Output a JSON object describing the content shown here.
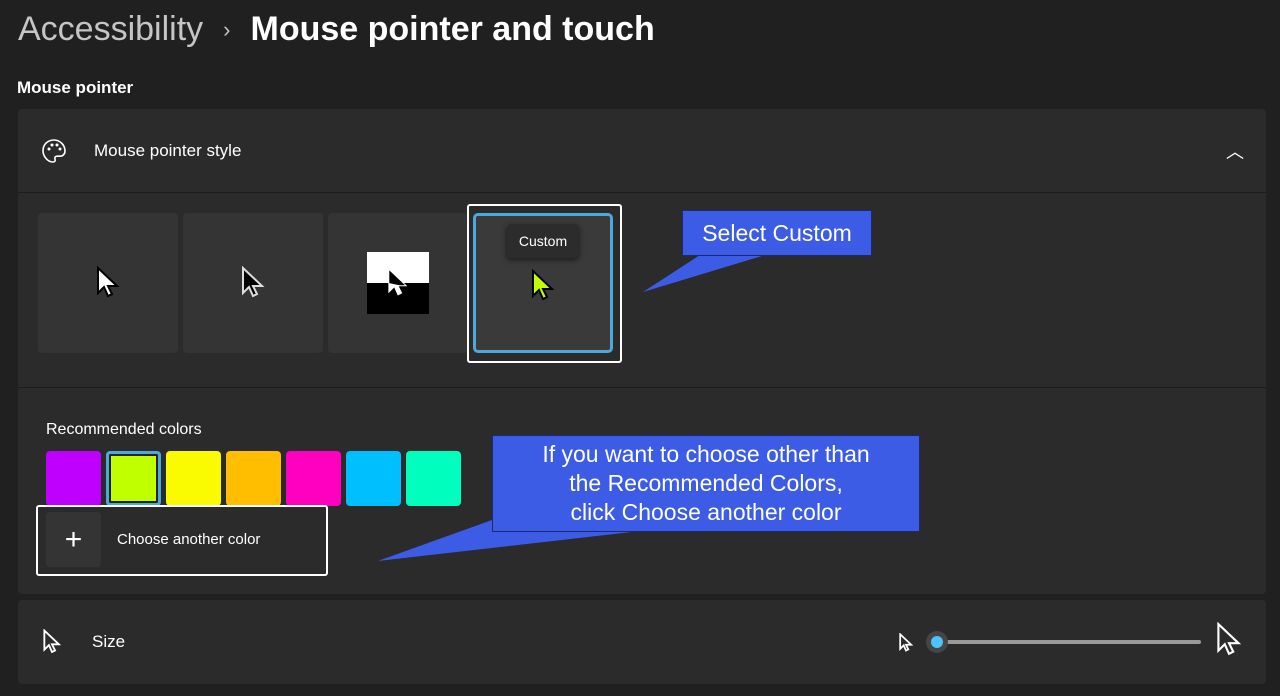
{
  "breadcrumb": {
    "parent": "Accessibility",
    "separator": "›",
    "current": "Mouse pointer and touch"
  },
  "section_title": "Mouse pointer",
  "pointer_style": {
    "label": "Mouse pointer style",
    "icon": "palette-icon",
    "expanded": true,
    "options": [
      {
        "name": "white"
      },
      {
        "name": "black"
      },
      {
        "name": "inverted"
      },
      {
        "name": "Custom",
        "tooltip": "Custom",
        "selected": true
      }
    ],
    "recommended_label": "Recommended colors",
    "colors": [
      "#C000FF",
      "#BFFF00",
      "#FAFA00",
      "#FFBF00",
      "#FF00C0",
      "#00BFFF",
      "#00FFBF"
    ],
    "selected_color_index": 1,
    "choose_another": "Choose another color"
  },
  "size": {
    "label": "Size",
    "value_percent": 0
  },
  "callouts": {
    "select_custom": "Select Custom",
    "choose_other": [
      "If you want to choose other than",
      "the Recommended Colors,",
      "click Choose another color"
    ]
  },
  "accent": "#4CC2FF"
}
